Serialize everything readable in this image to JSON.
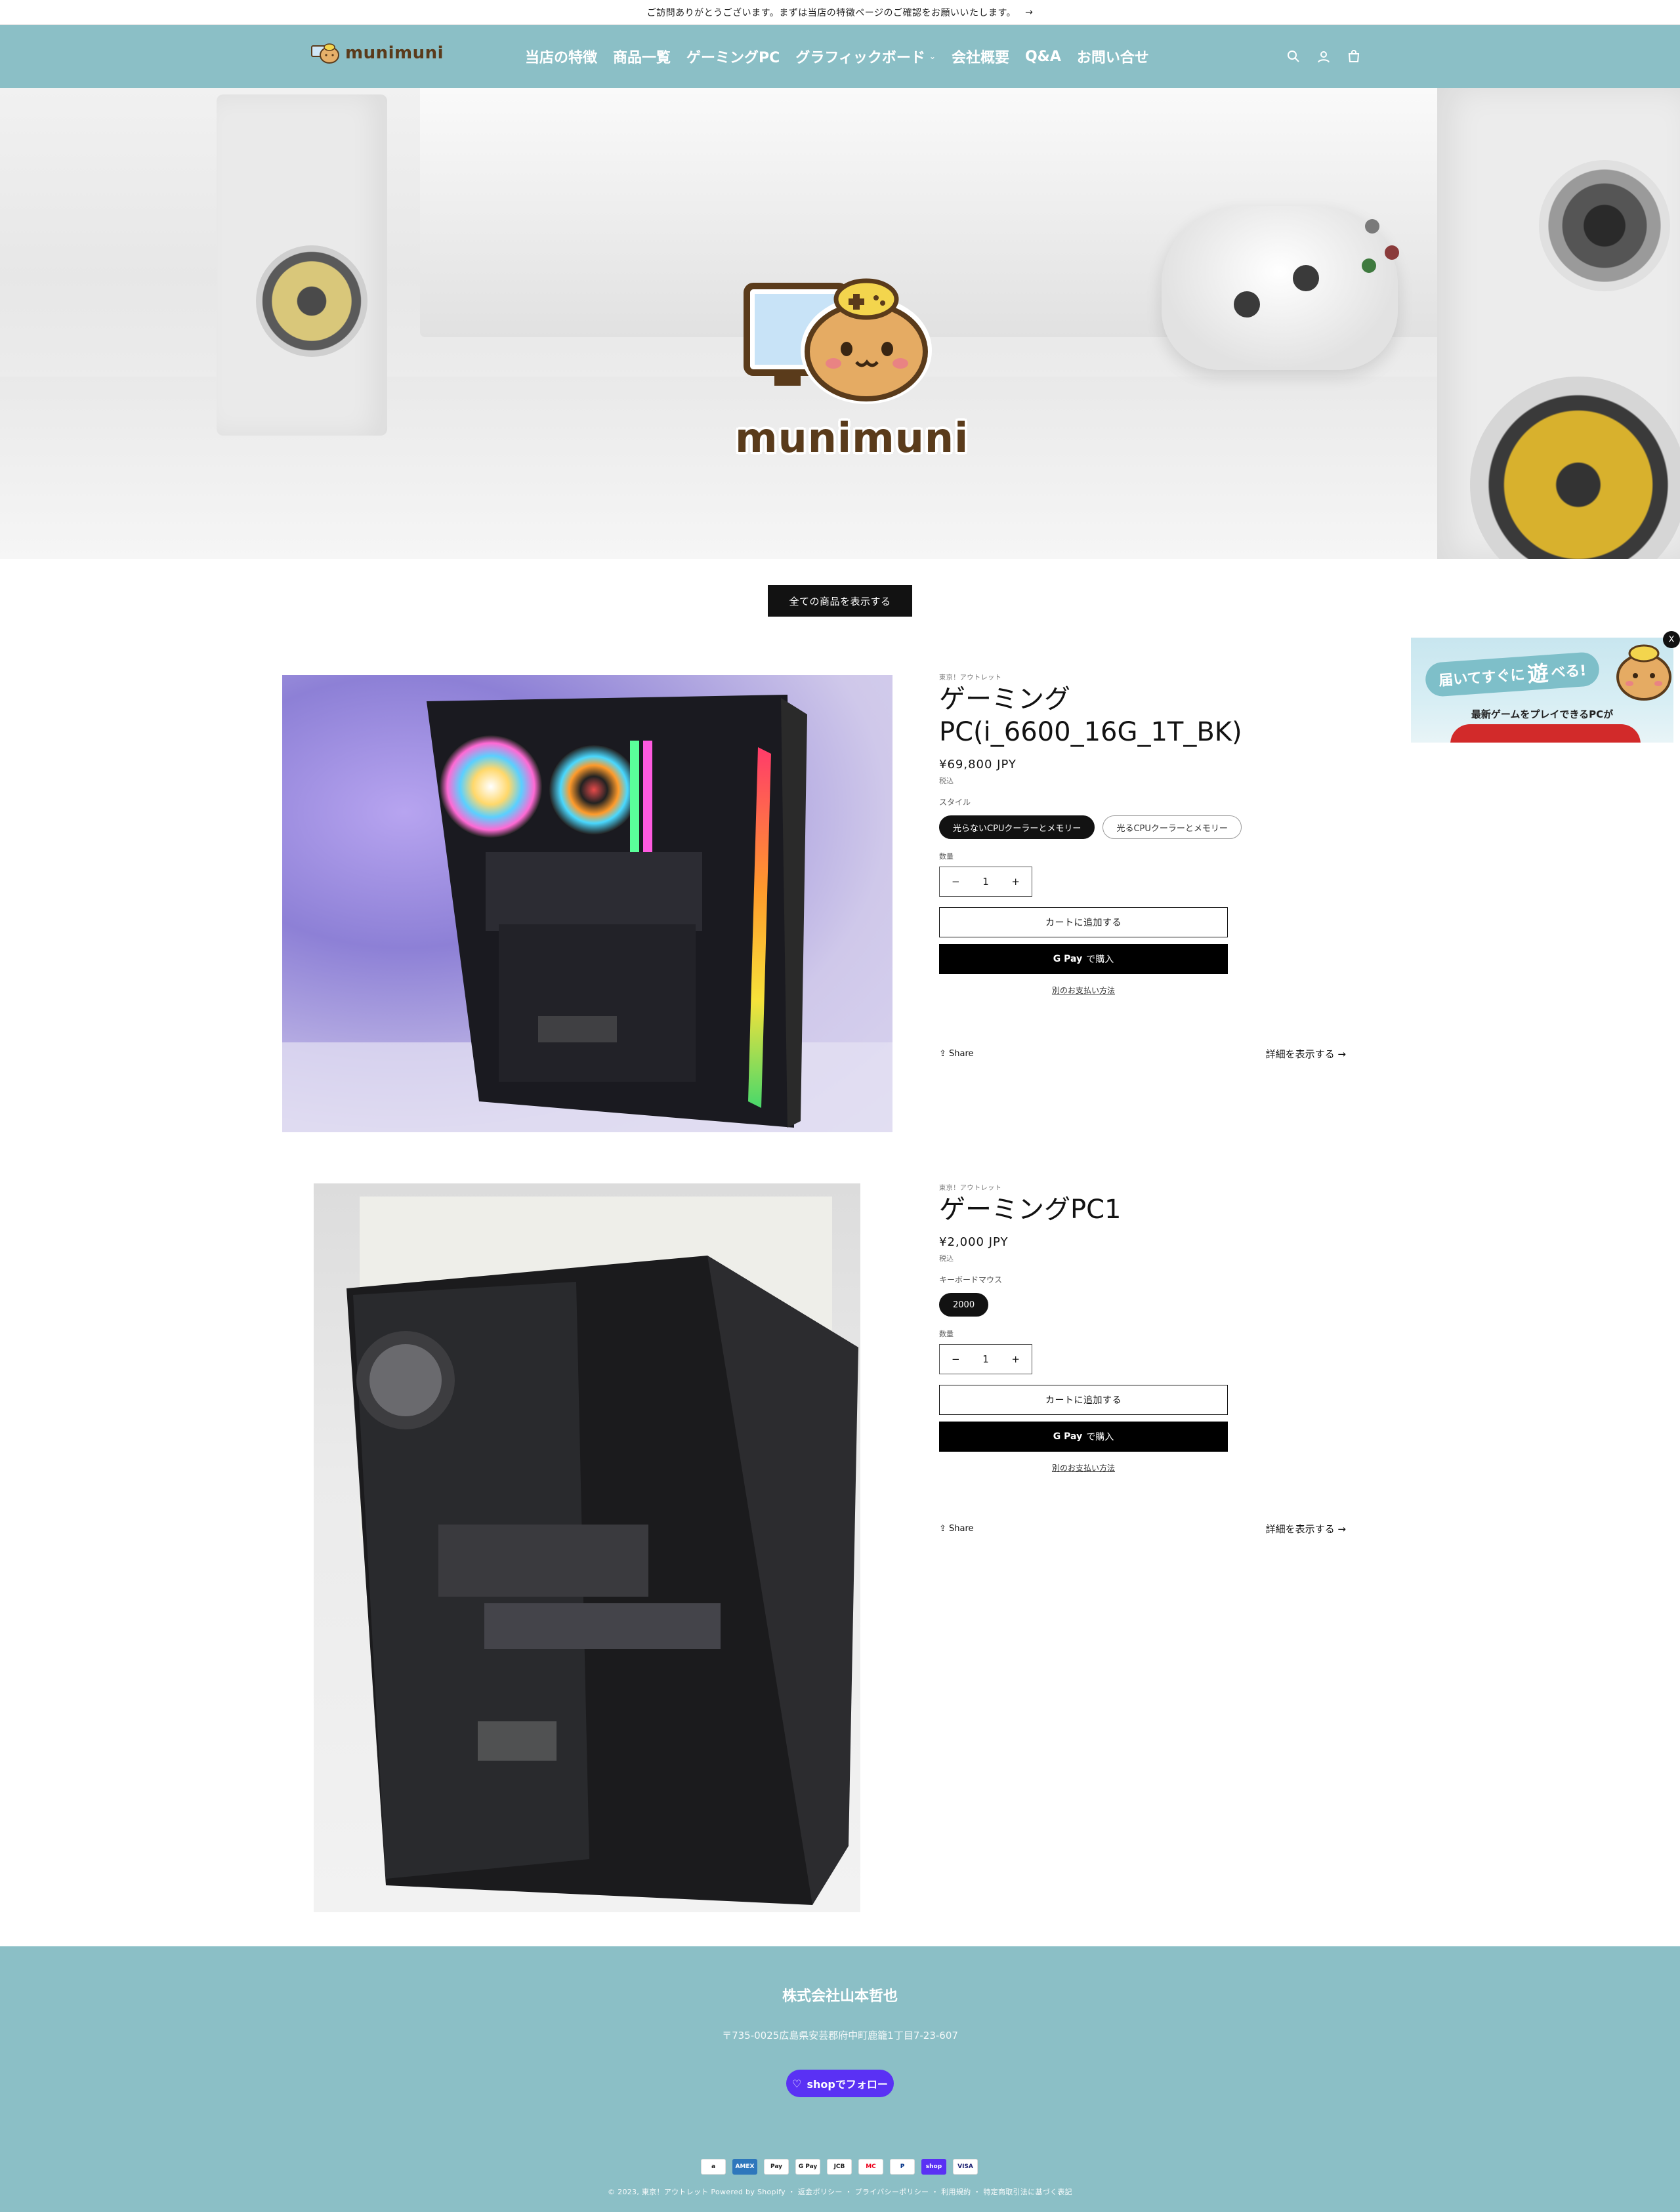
{
  "announcement": {
    "text": "ご訪問ありがとうございます。まずは当店の特徴ページのご確認をお願いいたします。",
    "arrow": "→"
  },
  "header": {
    "logo_text": "munimuni",
    "nav": [
      {
        "label": "当店の特徴"
      },
      {
        "label": "商品一覧"
      },
      {
        "label": "ゲーミングPC"
      },
      {
        "label": "グラフィックボード",
        "dropdown": "⌄"
      },
      {
        "label": "会社概要"
      },
      {
        "label": "Q&A"
      },
      {
        "label": "お問い合せ"
      }
    ],
    "icons": [
      "search-icon",
      "account-icon",
      "cart-icon"
    ]
  },
  "hero": {
    "logo_text": "munimuni"
  },
  "view_all_label": "全ての商品を表示する",
  "products": [
    {
      "vendor": "東京！アウトレット",
      "title": "ゲーミングPC(i_6600_16G_1T_BK)",
      "price": "¥69,800 JPY",
      "tax": "税込",
      "option_label": "スタイル",
      "options": [
        "光らないCPUクーラーとメモリー",
        "光るCPUクーラーとメモリー"
      ],
      "selected_option": 0,
      "qty_label": "数量",
      "qty": "1",
      "add_to_cart": "カートに追加する",
      "gpay_label": "で購入",
      "gpay_logo": "G Pay",
      "more_payment": "別のお支払い方法",
      "share": "Share",
      "details": "詳細を表示する"
    },
    {
      "vendor": "東京！アウトレット",
      "title": "ゲーミングPC1",
      "price": "¥2,000 JPY",
      "tax": "税込",
      "option_label": "キーボードマウス",
      "options": [
        "2000"
      ],
      "selected_option": 0,
      "qty_label": "数量",
      "qty": "1",
      "add_to_cart": "カートに追加する",
      "gpay_label": "で購入",
      "gpay_logo": "G Pay",
      "more_payment": "別のお支払い方法",
      "share": "Share",
      "details": "詳細を表示する"
    }
  ],
  "popup": {
    "line1": "届いてすぐに",
    "big": "遊",
    "line1b": "べる!",
    "line2": "最新ゲームをプレイできるPCが",
    "close": "X"
  },
  "footer": {
    "company": "株式会社山本哲也",
    "address": "〒735-0025広島県安芸郡府中町鹿籠1丁目7-23-607",
    "follow": "shopでフォロー",
    "payments": [
      "a",
      "AMEX",
      "Pay",
      "G Pay",
      "JCB",
      "MC",
      "P",
      "shop",
      "VISA"
    ],
    "legal": "© 2023, 東京！アウトレット Powered by Shopify ・ 返金ポリシー ・ プライバシーポリシー ・ 利用規約 ・ 特定商取引法に基づく表記"
  }
}
